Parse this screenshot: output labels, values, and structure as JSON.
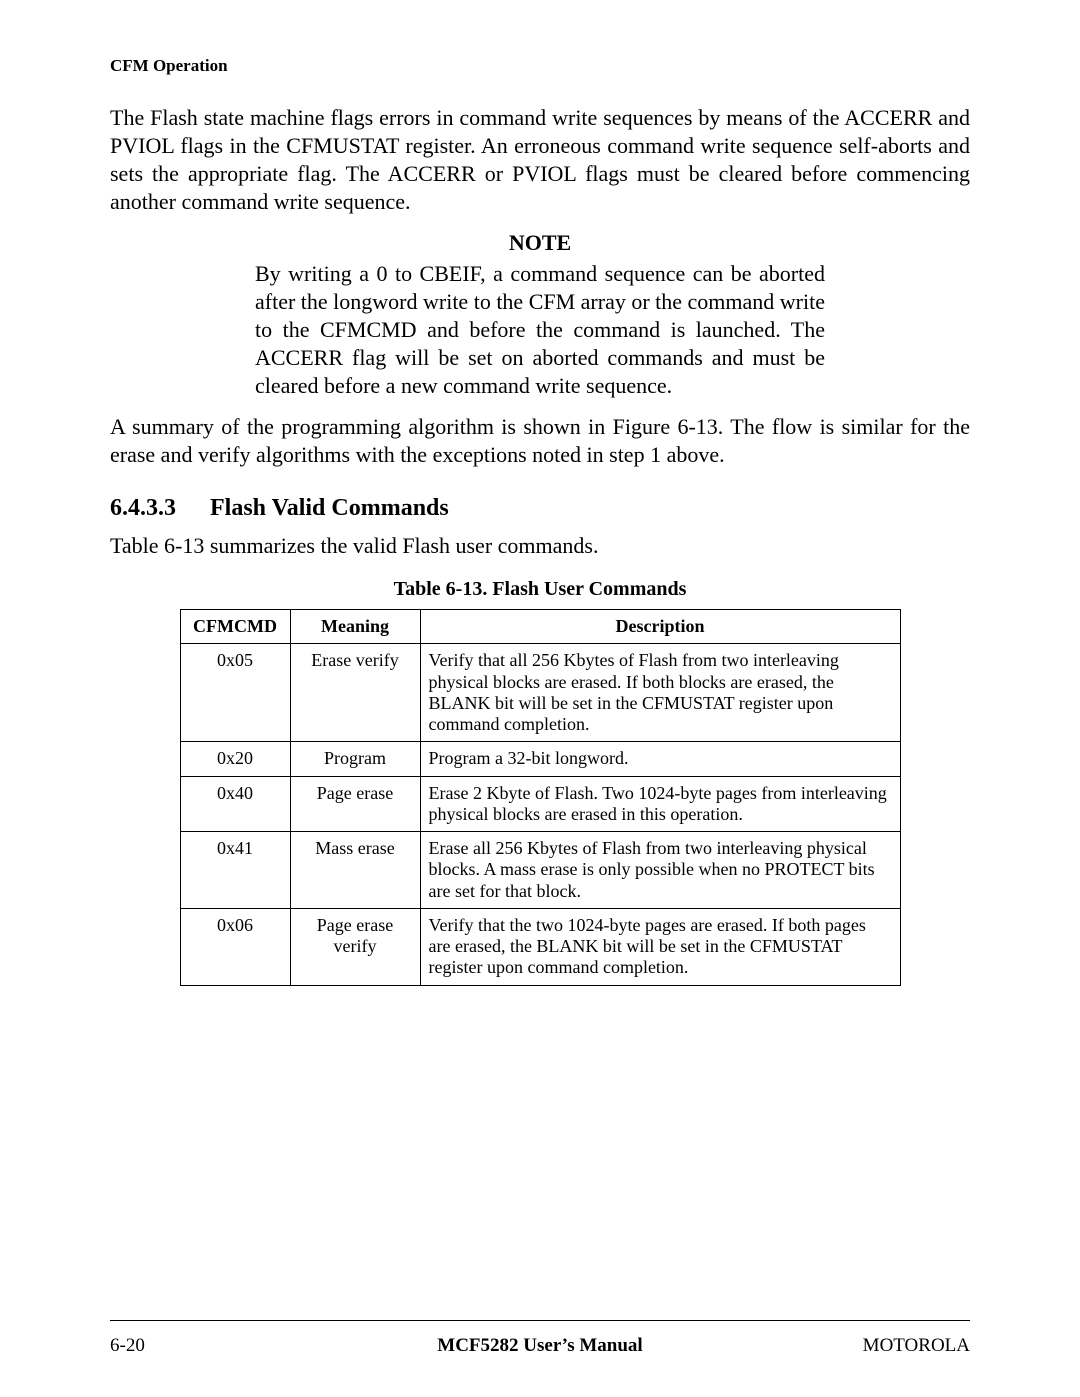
{
  "header": {
    "running": "CFM Operation"
  },
  "paragraphs": {
    "p1": "The Flash state machine flags errors in command write sequences by means of the ACCERR and PVIOL flags in the CFMUSTAT register. An erroneous command write sequence self-aborts and sets the appropriate flag. The ACCERR or PVIOL flags must be cleared before commencing another command write sequence.",
    "p2": "A summary of the programming algorithm is shown in Figure 6-13. The flow is similar for the erase and verify algorithms with the exceptions noted in step 1 above.",
    "p3": "Table 6-13 summarizes the valid Flash user commands."
  },
  "note": {
    "title": "NOTE",
    "body": "By writing a 0 to CBEIF, a command sequence can be aborted after the longword write to the CFM array or the command write to the CFMCMD and before the command is launched. The ACCERR flag will be set on aborted commands and must be cleared before a new command write sequence."
  },
  "section": {
    "number": "6.4.3.3",
    "title": "Flash Valid Commands"
  },
  "table": {
    "caption": "Table 6-13. Flash User Commands",
    "headers": {
      "c1": "CFMCMD",
      "c2": "Meaning",
      "c3": "Description"
    },
    "rows": [
      {
        "c1": "0x05",
        "c2": "Erase verify",
        "c3": "Verify that all 256 Kbytes of Flash from two interleaving physical blocks are erased. If both blocks are erased, the BLANK bit will be set in the CFMUSTAT register upon command completion."
      },
      {
        "c1": "0x20",
        "c2": "Program",
        "c3": "Program a 32-bit longword."
      },
      {
        "c1": "0x40",
        "c2": "Page erase",
        "c3": "Erase 2 Kbyte of Flash. Two 1024-byte pages from interleaving physical blocks are erased in this operation."
      },
      {
        "c1": "0x41",
        "c2": "Mass erase",
        "c3": "Erase all 256 Kbytes of Flash from two interleaving physical blocks. A mass erase is only possible when no PROTECT bits are set for that block."
      },
      {
        "c1": "0x06",
        "c2": "Page erase verify",
        "c3": "Verify that the two 1024-byte pages are erased. If both pages are erased, the BLANK bit will be set in the CFMUSTAT register upon command completion."
      }
    ]
  },
  "footer": {
    "left": "6-20",
    "center": "MCF5282 User’s Manual",
    "right": "MOTOROLA"
  }
}
